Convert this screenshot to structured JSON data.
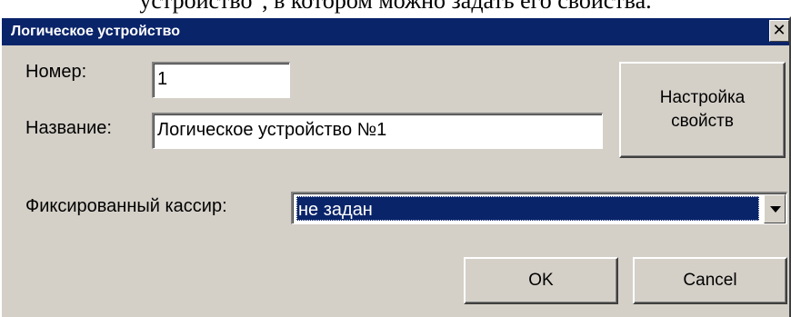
{
  "document_text": "устройство\", в котором можно задать его свойства.",
  "dialog": {
    "title": "Логическое устройство",
    "close_icon": "close-icon",
    "number_label": "Номер:",
    "number_value": "1",
    "name_label": "Название:",
    "name_value": "Логическое устройство №1",
    "settings_button": "Настройка\nсвойств",
    "cashier_label": "Фиксированный кассир:",
    "cashier_value": "не задан",
    "ok_button": "OK",
    "cancel_button": "Cancel"
  },
  "colors": {
    "titlebar": "#0a246a",
    "dialog_bg": "#d4d0c8",
    "selection": "#0a246a"
  }
}
